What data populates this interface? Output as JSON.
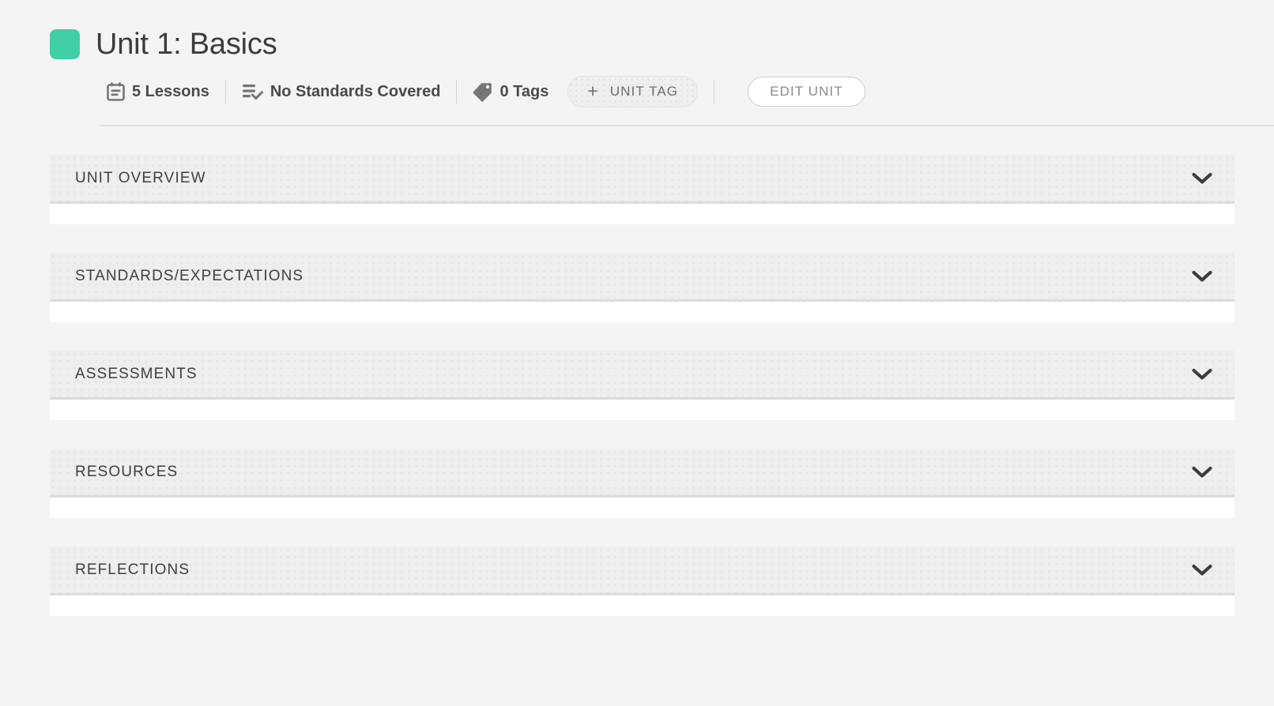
{
  "unit": {
    "title": "Unit 1: Basics",
    "swatch_color": "#40cfa8"
  },
  "meta": {
    "lessons": {
      "icon": "calendar-icon",
      "label": "5 Lessons"
    },
    "standards": {
      "icon": "standards-check-icon",
      "label": "No Standards Covered"
    },
    "tags": {
      "icon": "tag-icon",
      "label": "0 Tags"
    },
    "unit_tag_button": {
      "plus": "+",
      "label": "UNIT TAG"
    },
    "edit_unit_button": {
      "label": "EDIT UNIT"
    }
  },
  "sections": [
    {
      "label": "UNIT OVERVIEW",
      "chevron": "chevron-down-icon",
      "expanded": false
    },
    {
      "label": "STANDARDS/EXPECTATIONS",
      "chevron": "chevron-down-icon",
      "expanded": false
    },
    {
      "label": "ASSESSMENTS",
      "chevron": "chevron-down-icon",
      "expanded": false
    },
    {
      "label": "RESOURCES",
      "chevron": "chevron-down-icon",
      "expanded": false
    },
    {
      "label": "REFLECTIONS",
      "chevron": "chevron-down-icon",
      "expanded": false
    }
  ],
  "colors": {
    "page_background": "#f4f4f4",
    "section_header": "#eeeeee",
    "accent_green": "#40cfa8",
    "text_dark": "#3c3c3c",
    "text_muted": "#8b8b8b"
  }
}
